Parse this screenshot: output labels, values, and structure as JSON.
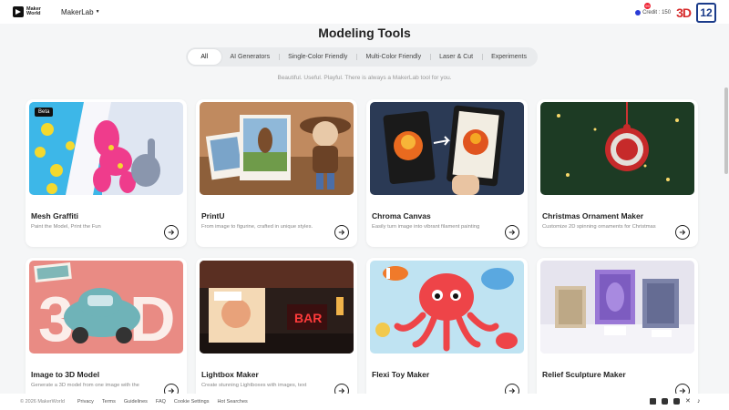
{
  "header": {
    "logo_text": "Maker World",
    "app_switch_label": "MakerLab",
    "notification_count": "99",
    "credit_label": "Credit : 150",
    "brand_badge": "3D",
    "avatar_text": "12"
  },
  "page": {
    "title": "Modeling Tools",
    "subtitle": "Beautiful. Useful. Playful. There is always a MakerLab tool for you."
  },
  "tabs": [
    {
      "label": "All",
      "active": true
    },
    {
      "label": "AI Generators",
      "active": false
    },
    {
      "label": "Single-Color Friendly",
      "active": false
    },
    {
      "label": "Multi-Color Friendly",
      "active": false
    },
    {
      "label": "Laser & Cut",
      "active": false
    },
    {
      "label": "Experiments",
      "active": false
    }
  ],
  "cards": [
    {
      "name": "Mesh Graffiti",
      "desc": "Paint the Model, Print the Fun",
      "badge": "Beta",
      "icon": "mesh-graffiti-image"
    },
    {
      "name": "PrintU",
      "desc": "From image to figurine, crafted in unique styles.",
      "icon": "printu-image"
    },
    {
      "name": "Chroma Canvas",
      "desc": "Easily turn image into vibrant filament painting",
      "icon": "chroma-canvas-image"
    },
    {
      "name": "Christmas Ornament Maker",
      "desc": "Customize 2D spinning ornaments for Christmas",
      "icon": "ornament-image"
    },
    {
      "name": "Image to 3D Model",
      "desc": "Generate a 3D model from one image with the",
      "icon": "image-to-3d-image"
    },
    {
      "name": "Lightbox Maker",
      "desc": "Create stunning Lightboxes with images, text",
      "icon": "lightbox-image"
    },
    {
      "name": "Flexi Toy Maker",
      "desc": "",
      "icon": "flexi-toy-image"
    },
    {
      "name": "Relief Sculpture Maker",
      "desc": "",
      "icon": "relief-image"
    }
  ],
  "footer": {
    "copyright": "© 2026 MakerWorld",
    "links": [
      "Privacy",
      "Terms",
      "Guidelines",
      "FAQ",
      "Cookie Settings",
      "Hot Searches"
    ],
    "social_icons": [
      "facebook-icon",
      "instagram-icon",
      "youtube-icon",
      "x-icon",
      "tiktok-icon"
    ]
  },
  "colors": {
    "background": "#f5f6f7",
    "accent_red": "#d72c2c",
    "avatar_blue": "#1a3b8a"
  }
}
